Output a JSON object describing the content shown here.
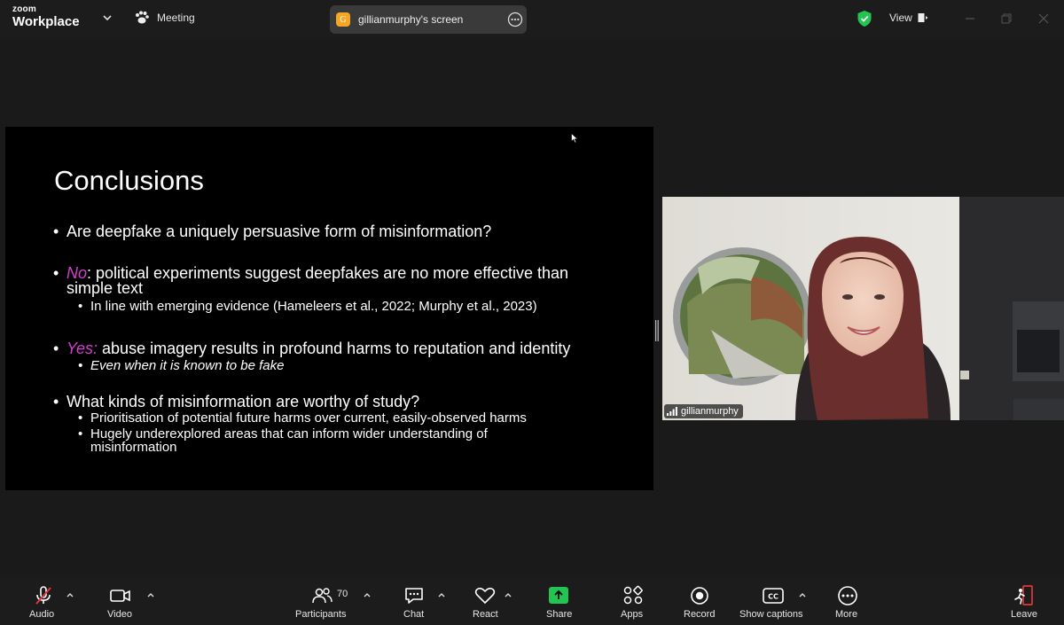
{
  "app": {
    "logo_top": "zoom",
    "logo_bottom": "Workplace",
    "meeting_label": "Meeting"
  },
  "share": {
    "avatar_letter": "G",
    "label": "gillianmurphy's screen"
  },
  "view_label": "View",
  "slide": {
    "title": "Conclusions",
    "bullets": [
      {
        "text": "Are deepfake a uniquely persuasive form of misinformation?"
      },
      {
        "lead": "No",
        "text": ": political experiments suggest deepfakes are no more effective than",
        "text2": "simple text",
        "sub": "In line with emerging evidence (Hameleers et al., 2022; Murphy et al., 2023)"
      },
      {
        "lead": "Yes:",
        "text": " abuse imagery results in profound harms to reputation and identity",
        "sub": "Even when it is known to be fake"
      },
      {
        "text": "What kinds of misinformation are worthy of study?",
        "sub1": "Prioritisation of potential future harms over current, easily-observed harms",
        "sub2": "Hugely underexplored areas that can inform wider understanding of",
        "sub2b": "misinformation"
      }
    ]
  },
  "video": {
    "participant_name": "gillianmurphy"
  },
  "toolbar": {
    "audio": "Audio",
    "video": "Video",
    "participants": "Participants",
    "participants_count": "70",
    "chat": "Chat",
    "react": "React",
    "share": "Share",
    "apps": "Apps",
    "record": "Record",
    "captions": "Show captions",
    "more": "More",
    "leave": "Leave"
  },
  "colors": {
    "accent_green": "#23c552",
    "highlight_pink": "#d63fd1",
    "leave_red": "#e0383e"
  }
}
